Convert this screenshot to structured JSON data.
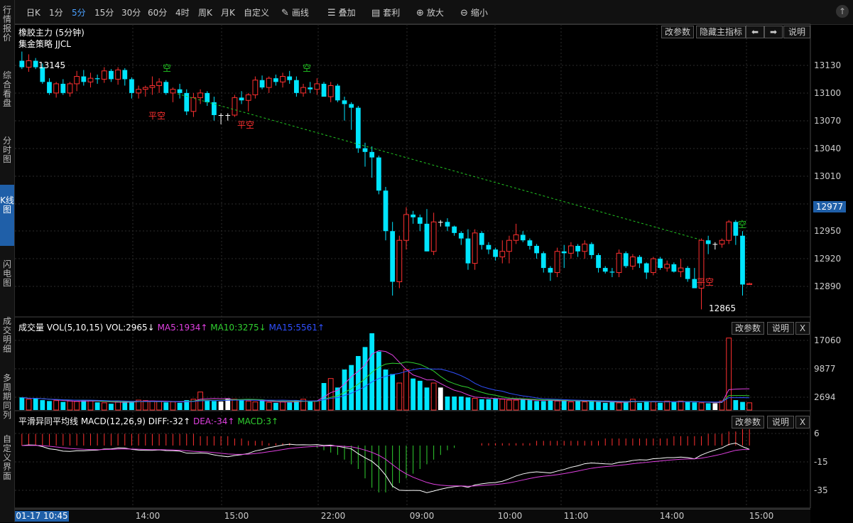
{
  "left_tabs": [
    {
      "label": "行情报价",
      "active": false
    },
    {
      "label": "综合看盘",
      "active": false
    },
    {
      "label": "分时图",
      "active": false
    },
    {
      "label": "K线图",
      "active": true
    },
    {
      "label": "闪电图",
      "active": false
    },
    {
      "label": "成交明细",
      "active": false
    },
    {
      "label": "多周期同列",
      "active": false
    },
    {
      "label": "自定义界面",
      "active": false
    }
  ],
  "toolbar": {
    "periods": [
      "日K",
      "1分",
      "5分",
      "15分",
      "30分",
      "60分",
      "4时",
      "周K",
      "月K",
      "自定义"
    ],
    "active_period": "5分",
    "draw": "画线",
    "overlay": "叠加",
    "arbitrage": "套利",
    "zoom_in": "放大",
    "zoom_out": "缩小",
    "corner": "↑"
  },
  "main": {
    "title": "橡胶主力 (5分钟)",
    "strategy": "集金策略 JJCL",
    "buttons": {
      "params": "改参数",
      "hide_indicator": "隐藏主指标",
      "left": "⬅",
      "right": "➡",
      "help": "说明"
    },
    "high_label": "13145",
    "low_label": "12865",
    "signals": {
      "short": "空",
      "close_short": "平空"
    },
    "current_price": "12977",
    "y_ticks": [
      13130,
      13100,
      13070,
      13040,
      13010,
      12950,
      12920,
      12890
    ]
  },
  "volume": {
    "title": "成交量",
    "params": "VOL(5,10,15)",
    "vol": "VOL:2965↓",
    "ma5": "MA5:1934↑",
    "ma10": "MA10:3275↓",
    "ma15": "MA15:5561↑",
    "colors": {
      "ma5": "#e040e0",
      "ma10": "#30d030",
      "ma15": "#3050ff"
    },
    "buttons": {
      "params": "改参数",
      "help": "说明",
      "close": "X"
    },
    "y_ticks": [
      "17060",
      "9877",
      "2694"
    ]
  },
  "macd": {
    "title": "平滑异同平均线 MACD(12,26,9)",
    "diff": "DIFF:-32↑",
    "dea": "DEA:-34↑",
    "macd": "MACD:3↑",
    "buttons": {
      "params": "改参数",
      "help": "说明",
      "close": "X"
    },
    "y_ticks": [
      "6",
      "-15",
      "-35"
    ]
  },
  "time_axis": {
    "cursor_time": "01-17 10:45",
    "labels": [
      "14:00",
      "15:00",
      "22:00",
      "09:00",
      "10:00",
      "11:00",
      "14:00",
      "15:00"
    ]
  },
  "colors": {
    "up": "#ff3030",
    "down": "#00e5ff",
    "doji": "#ffffff",
    "accent": "#1f5fa8",
    "trendline": "#22c722"
  },
  "chart_data": {
    "type": "candlestick",
    "ohlc": [
      [
        13135,
        13145,
        13126,
        13128
      ],
      [
        13128,
        13142,
        13123,
        13135
      ],
      [
        13135,
        13138,
        13126,
        13128
      ],
      [
        13128,
        13132,
        13110,
        13112
      ],
      [
        13112,
        13116,
        13098,
        13100
      ],
      [
        13100,
        13112,
        13095,
        13110
      ],
      [
        13110,
        13115,
        13098,
        13100
      ],
      [
        13100,
        13112,
        13096,
        13110
      ],
      [
        13110,
        13124,
        13102,
        13118
      ],
      [
        13118,
        13125,
        13108,
        13112
      ],
      [
        13112,
        13122,
        13106,
        13116
      ],
      [
        13116,
        13120,
        13110,
        13115
      ],
      [
        13115,
        13128,
        13111,
        13124
      ],
      [
        13124,
        13126,
        13112,
        13115
      ],
      [
        13115,
        13128,
        13109,
        13125
      ],
      [
        13125,
        13127,
        13108,
        13115
      ],
      [
        13115,
        13117,
        13094,
        13100
      ],
      [
        13100,
        13108,
        13094,
        13104
      ],
      [
        13104,
        13108,
        13096,
        13106
      ],
      [
        13106,
        13118,
        13098,
        13108
      ],
      [
        13108,
        13116,
        13100,
        13112
      ],
      [
        13112,
        13114,
        13098,
        13100
      ],
      [
        13100,
        13106,
        13090,
        13104
      ],
      [
        13104,
        13110,
        13094,
        13100
      ],
      [
        13100,
        13104,
        13076,
        13080
      ],
      [
        13080,
        13100,
        13074,
        13095
      ],
      [
        13095,
        13104,
        13088,
        13100
      ],
      [
        13100,
        13102,
        13086,
        13090
      ],
      [
        13090,
        13096,
        13070,
        13076
      ],
      [
        13076,
        13078,
        13066,
        13076
      ],
      [
        13076,
        13078,
        13070,
        13076
      ],
      [
        13076,
        13098,
        13074,
        13095
      ],
      [
        13095,
        13102,
        13088,
        13092
      ],
      [
        13092,
        13100,
        13080,
        13098
      ],
      [
        13098,
        13118,
        13094,
        13114
      ],
      [
        13114,
        13119,
        13104,
        13106
      ],
      [
        13106,
        13118,
        13100,
        13116
      ],
      [
        13116,
        13120,
        13108,
        13112
      ],
      [
        13112,
        13122,
        13106,
        13118
      ],
      [
        13118,
        13124,
        13110,
        13114
      ],
      [
        13114,
        13118,
        13096,
        13100
      ],
      [
        13100,
        13110,
        13096,
        13106
      ],
      [
        13106,
        13112,
        13100,
        13104
      ],
      [
        13104,
        13116,
        13098,
        13110
      ],
      [
        13110,
        13112,
        13096,
        13096
      ],
      [
        13096,
        13112,
        13090,
        13108
      ],
      [
        13108,
        13110,
        13090,
        13092
      ],
      [
        13092,
        13096,
        13070,
        13088
      ],
      [
        13088,
        13090,
        13060,
        13084
      ],
      [
        13084,
        13086,
        13035,
        13040
      ],
      [
        13040,
        13046,
        13020,
        13036
      ],
      [
        13036,
        13042,
        13008,
        13030
      ],
      [
        13030,
        13032,
        12990,
        12994
      ],
      [
        12994,
        12998,
        12940,
        12950
      ],
      [
        12950,
        12960,
        12880,
        12895
      ],
      [
        12895,
        12945,
        12888,
        12940
      ],
      [
        12940,
        12976,
        12930,
        12968
      ],
      [
        12968,
        12972,
        12958,
        12965
      ],
      [
        12965,
        12968,
        12950,
        12958
      ],
      [
        12958,
        12974,
        12928,
        12928
      ],
      [
        12928,
        12970,
        12924,
        12960
      ],
      [
        12960,
        12962,
        12955,
        12960
      ],
      [
        12960,
        12964,
        12950,
        12955
      ],
      [
        12955,
        12956,
        12945,
        12948
      ],
      [
        12948,
        12950,
        12935,
        12942
      ],
      [
        12942,
        12952,
        12908,
        12915
      ],
      [
        12915,
        12952,
        12908,
        12948
      ],
      [
        12948,
        12950,
        12930,
        12935
      ],
      [
        12935,
        12938,
        12925,
        12930
      ],
      [
        12930,
        12932,
        12918,
        12922
      ],
      [
        12922,
        12940,
        12915,
        12928
      ],
      [
        12928,
        12945,
        12915,
        12940
      ],
      [
        12940,
        12958,
        12936,
        12946
      ],
      [
        12946,
        12950,
        12938,
        12940
      ],
      [
        12940,
        12942,
        12930,
        12934
      ],
      [
        12934,
        12936,
        12920,
        12926
      ],
      [
        12926,
        12928,
        12905,
        12910
      ],
      [
        12910,
        12912,
        12896,
        12905
      ],
      [
        12905,
        12932,
        12900,
        12928
      ],
      [
        12928,
        12935,
        12910,
        12926
      ],
      [
        12926,
        12938,
        12920,
        12934
      ],
      [
        12934,
        12936,
        12922,
        12928
      ],
      [
        12928,
        12940,
        12920,
        12936
      ],
      [
        12936,
        12938,
        12920,
        12924
      ],
      [
        12924,
        12926,
        12905,
        12910
      ],
      [
        12910,
        12912,
        12904,
        12906
      ],
      [
        12906,
        12910,
        12900,
        12905
      ],
      [
        12905,
        12930,
        12900,
        12926
      ],
      [
        12926,
        12928,
        12910,
        12912
      ],
      [
        12912,
        12925,
        12908,
        12922
      ],
      [
        12922,
        12924,
        12910,
        12915
      ],
      [
        12915,
        12916,
        12898,
        12905
      ],
      [
        12905,
        12922,
        12902,
        12920
      ],
      [
        12920,
        12922,
        12908,
        12910
      ],
      [
        12910,
        12918,
        12906,
        12914
      ],
      [
        12914,
        12916,
        12905,
        12906
      ],
      [
        12906,
        12920,
        12900,
        12910
      ],
      [
        12910,
        12912,
        12895,
        12898
      ],
      [
        12898,
        12910,
        12890,
        12888
      ],
      [
        12888,
        12942,
        12865,
        12940
      ],
      [
        12940,
        12945,
        12925,
        12936
      ],
      [
        12936,
        12938,
        12930,
        12936
      ],
      [
        12936,
        12942,
        12932,
        12940
      ],
      [
        12940,
        12962,
        12936,
        12960
      ],
      [
        12960,
        12962,
        12935,
        12945
      ],
      [
        12945,
        12950,
        12880,
        12892
      ],
      [
        12892,
        12894,
        12892,
        12893
      ]
    ],
    "volume": [
      2800,
      2400,
      2600,
      2200,
      2000,
      2100,
      1800,
      2000,
      1900,
      2200,
      2100,
      1700,
      1600,
      1400,
      1900,
      2000,
      1800,
      2200,
      2100,
      2000,
      1900,
      1700,
      1800,
      1600,
      2200,
      2400,
      4000,
      2200,
      2000,
      1900,
      2600,
      2400,
      2200,
      2000,
      1800,
      2100,
      1700,
      1600,
      1800,
      1700,
      2200,
      2400,
      1900,
      2000,
      6000,
      7000,
      5000,
      9000,
      10000,
      12000,
      14000,
      17060,
      13000,
      9000,
      8000,
      6000,
      9000,
      7000,
      6500,
      5000,
      6000,
      5000,
      3000,
      3000,
      3000,
      2800,
      2600,
      2400,
      2400,
      2600,
      2400,
      2200,
      2200,
      2400,
      2200,
      2000,
      2000,
      2200,
      2000,
      2200,
      1800,
      2000,
      1800,
      2000,
      1800,
      1600,
      1800,
      1600,
      1800,
      2400,
      1600,
      2000,
      1800,
      1600,
      2000,
      1800,
      2000,
      1900,
      1700,
      1600,
      1500,
      1500,
      2000,
      16000,
      2200,
      1800,
      1600,
      1800,
      2965,
      9200,
      2965
    ],
    "macd_bars": [
      5,
      5,
      5,
      5,
      5,
      5,
      5,
      5,
      5,
      5,
      5,
      5,
      5,
      5,
      5,
      5,
      5,
      5,
      5,
      5,
      5,
      5,
      5,
      5,
      5,
      5,
      4,
      4,
      4,
      4,
      4,
      3,
      3,
      2,
      2,
      2,
      1,
      1,
      1,
      1,
      0,
      0,
      0,
      -1,
      -2,
      -3,
      -4,
      -6,
      -8,
      -10,
      -14,
      -18,
      -20,
      -20,
      -18,
      -16,
      -14,
      -12,
      -10,
      -8,
      -6,
      -4,
      -2,
      -1,
      0,
      0,
      0,
      1,
      1,
      1,
      1,
      1,
      1,
      1,
      1,
      2,
      2,
      2,
      2,
      2,
      2,
      2,
      2,
      2,
      2,
      3,
      3,
      3,
      3,
      3,
      3,
      3,
      3,
      3,
      3,
      4,
      4,
      4,
      4,
      4,
      5,
      5,
      5,
      6,
      6,
      7,
      7,
      8,
      8,
      9,
      9,
      6,
      3
    ]
  }
}
